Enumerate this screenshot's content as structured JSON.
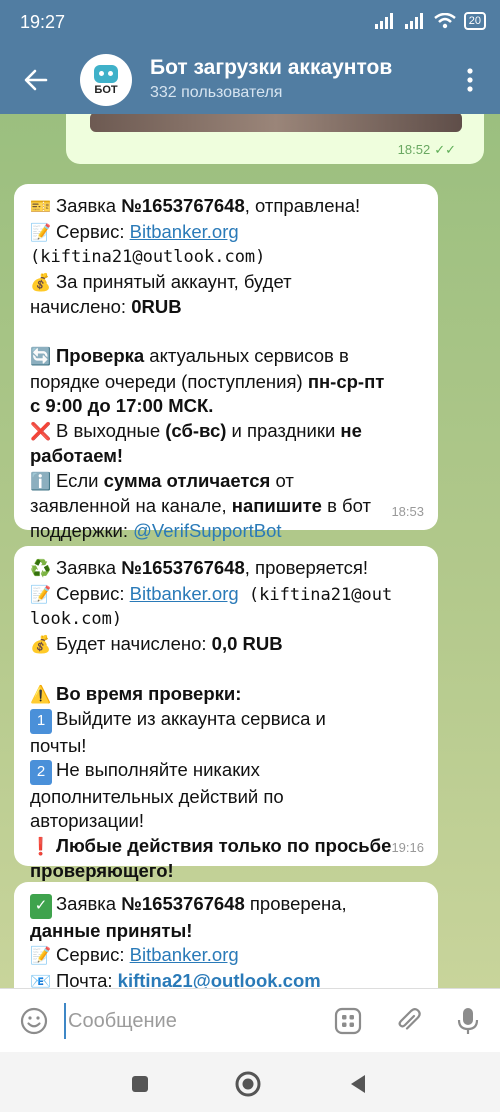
{
  "status": {
    "time": "19:27",
    "battery": "20"
  },
  "header": {
    "avatar_label": "БОТ",
    "title": "Бот загрузки аккаунтов",
    "subtitle": "332 пользователя"
  },
  "outgoing": {
    "time": "18:52"
  },
  "messages": [
    {
      "time": "18:53",
      "l1_a": "Заявка ",
      "l1_b": "№1653767648",
      "l1_c": ", отправлена!",
      "l2_a": "Сервис: ",
      "l2_link": "Bitbanker.org",
      "l3": "(kiftina21@outlook.com)",
      "l4": "За принятый аккаунт, будет",
      "l5_a": "начислено: ",
      "l5_b": "0RUB",
      "l6_a": "Проверка",
      "l6_b": " актуальных сервисов в",
      "l7_a": "порядке очереди (поступления) ",
      "l7_b": "пн-ср-пт",
      "l8": "с 9:00 до 17:00 МСК.",
      "l9_a": "В выходные ",
      "l9_b": "(сб-вс)",
      "l9_c": " и праздники ",
      "l9_d": "не",
      "l10": "работаем!",
      "l11_a": "Если ",
      "l11_b": "сумма отличается",
      "l11_c": " от",
      "l12_a": "заявленной на канале,  ",
      "l12_b": "напишите",
      "l12_c": " в бот",
      "l13_a": "поддержки: ",
      "l13_link": "@VerifSupportBot"
    },
    {
      "time": "19:16",
      "l1_a": "Заявка ",
      "l1_b": "№1653767648",
      "l1_c": ", проверяется!",
      "l2_a": "Сервис: ",
      "l2_link": "Bitbanker.org",
      "l2_b": " (kiftina21@out",
      "l3": "look.com)",
      "l4_a": "Будет начислено: ",
      "l4_b": "0,0 RUB",
      "l5": "Во время проверки:",
      "l6": "Выйдите из аккаунта сервиса и",
      "l7": "почты!",
      "l8": "Не выполняйте никаких",
      "l9": "дополнительных действий по",
      "l10": "авторизации!",
      "l11": "Любые действия только по просьбе",
      "l12": "проверяющего!",
      "num1": "1",
      "num2": "2"
    },
    {
      "l1_a": "Заявка ",
      "l1_b": "№1653767648",
      "l1_c": " проверена,",
      "l2": "данные приняты!",
      "l3_a": "Сервис: ",
      "l3_link": "Bitbanker.org",
      "l4_a": "Почта: ",
      "l4_link": "kiftina21@outlook.com"
    }
  ],
  "composer": {
    "placeholder": "Сообщение"
  },
  "colors": {
    "header": "#517da2",
    "link": "#2a7ab8",
    "outgoing_bubble": "#effedd",
    "accent_green": "#5fae57"
  }
}
